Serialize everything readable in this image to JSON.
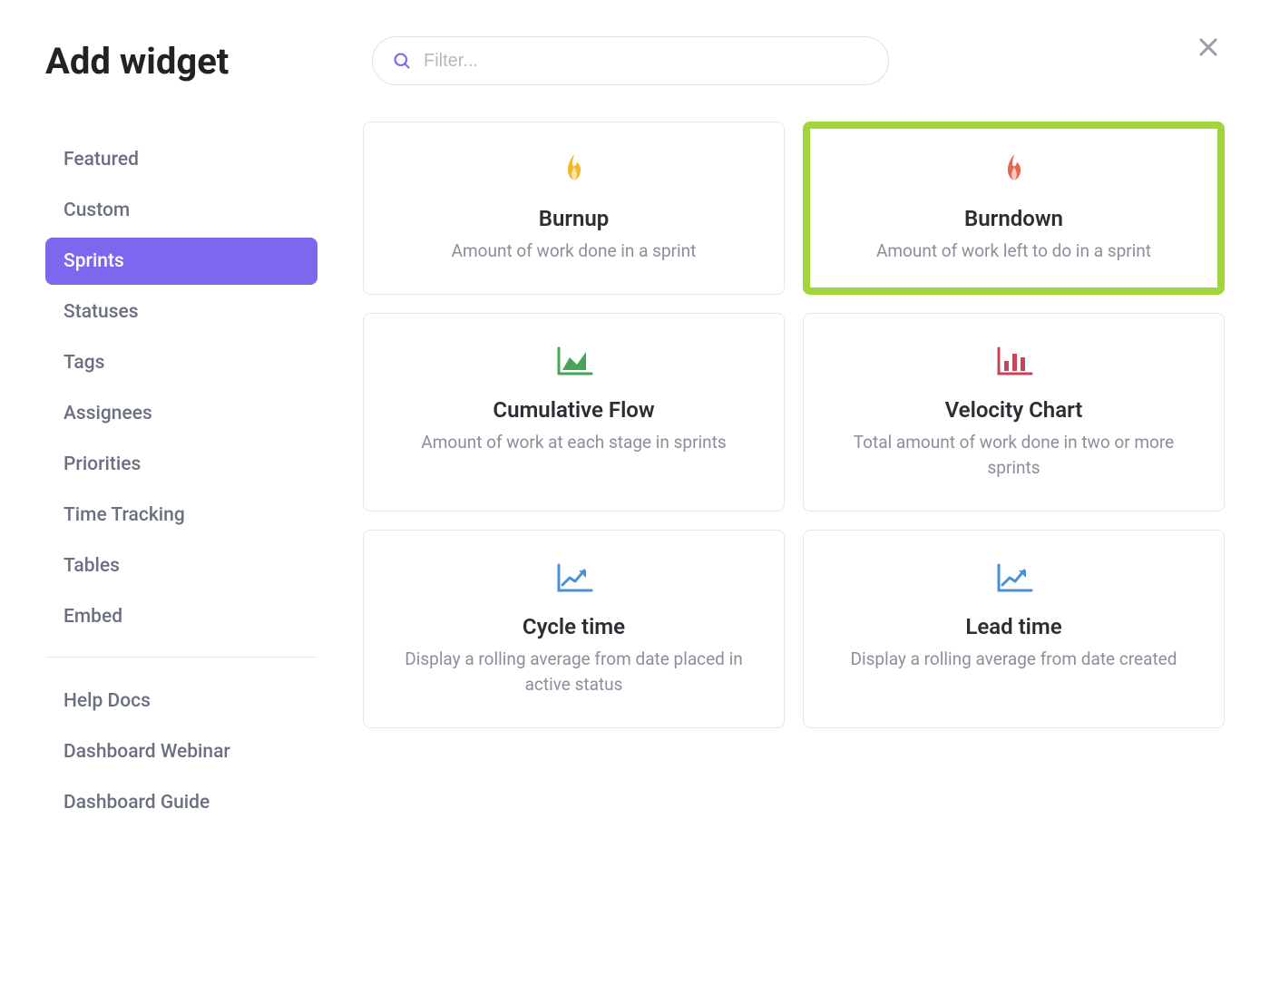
{
  "header": {
    "title": "Add widget",
    "search_placeholder": "Filter..."
  },
  "sidebar": {
    "categories": [
      {
        "label": "Featured",
        "active": false
      },
      {
        "label": "Custom",
        "active": false
      },
      {
        "label": "Sprints",
        "active": true
      },
      {
        "label": "Statuses",
        "active": false
      },
      {
        "label": "Tags",
        "active": false
      },
      {
        "label": "Assignees",
        "active": false
      },
      {
        "label": "Priorities",
        "active": false
      },
      {
        "label": "Time Tracking",
        "active": false
      },
      {
        "label": "Tables",
        "active": false
      },
      {
        "label": "Embed",
        "active": false
      }
    ],
    "help_links": [
      {
        "label": "Help Docs"
      },
      {
        "label": "Dashboard Webinar"
      },
      {
        "label": "Dashboard Guide"
      }
    ]
  },
  "widgets": [
    {
      "icon": "flame-yellow",
      "title": "Burnup",
      "desc": "Amount of work done in a sprint",
      "highlighted": false
    },
    {
      "icon": "flame-orange",
      "title": "Burndown",
      "desc": "Amount of work left to do in a sprint",
      "highlighted": true
    },
    {
      "icon": "area-chart",
      "title": "Cumulative Flow",
      "desc": "Amount of work at each stage in sprints",
      "highlighted": false
    },
    {
      "icon": "bar-chart",
      "title": "Velocity Chart",
      "desc": "Total amount of work done in two or more sprints",
      "highlighted": false
    },
    {
      "icon": "line-up",
      "title": "Cycle time",
      "desc": "Display a rolling average from date placed in active status",
      "highlighted": false
    },
    {
      "icon": "line-up",
      "title": "Lead time",
      "desc": "Display a rolling average from date created",
      "highlighted": false
    }
  ],
  "colors": {
    "accent": "#7b68ee",
    "highlight_border": "#a2d43c"
  }
}
